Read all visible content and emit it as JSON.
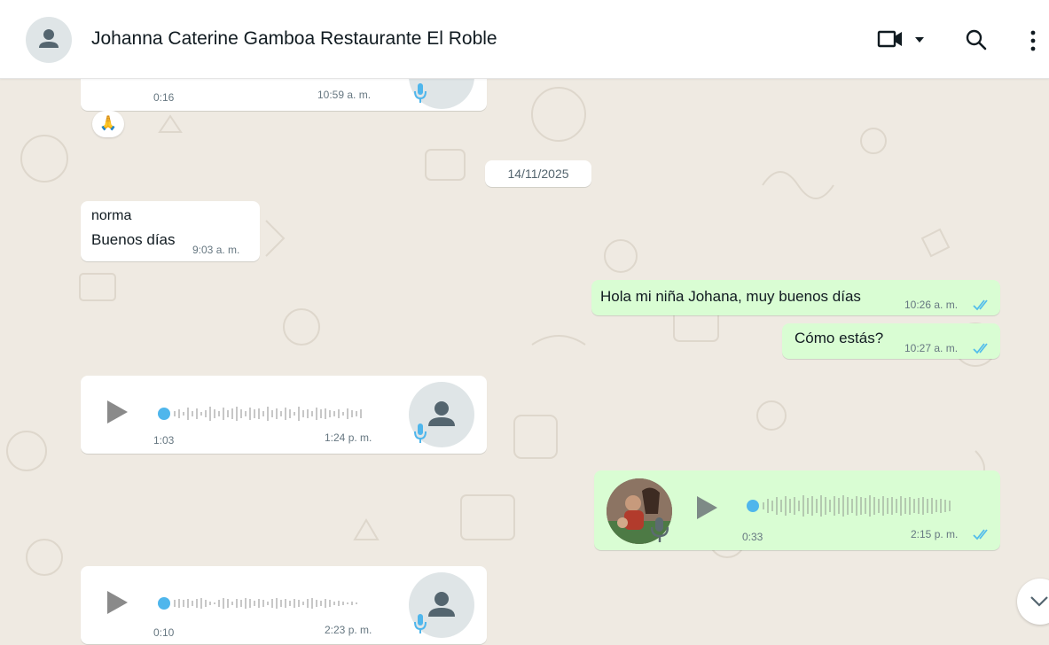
{
  "header": {
    "contact_name": "Johanna Caterine Gamboa Restaurante El Roble"
  },
  "colors": {
    "incoming_bubble": "#ffffff",
    "outgoing_bubble": "#d9fdd3",
    "read_ticks": "#53bdeb",
    "wave_dot": "#4fb6ec",
    "chat_background": "#efeae2"
  },
  "icons": [
    "person-icon",
    "video-call-icon",
    "dropdown-icon",
    "search-icon",
    "menu-icon",
    "play-icon",
    "mic-icon",
    "double-check-icon",
    "chevron-down-icon"
  ],
  "messages": {
    "m0": {
      "duration": "0:16",
      "time": "10:59 a. m.",
      "reaction": "🙏"
    },
    "date_chip": "14/11/2025",
    "m1": {
      "sender": "norma",
      "text": "Buenos días",
      "time": "9:03 a. m."
    },
    "m2": {
      "text": "Hola mi niña Johana, muy buenos días",
      "time": "10:26 a. m."
    },
    "m3": {
      "text": "Cómo estás?",
      "time": "10:27 a. m."
    },
    "m4": {
      "duration": "1:03",
      "time": "1:24 p. m."
    },
    "m5": {
      "duration": "0:33",
      "time": "2:15 p. m."
    },
    "m6": {
      "duration": "0:10",
      "time": "2:23 p. m."
    }
  }
}
